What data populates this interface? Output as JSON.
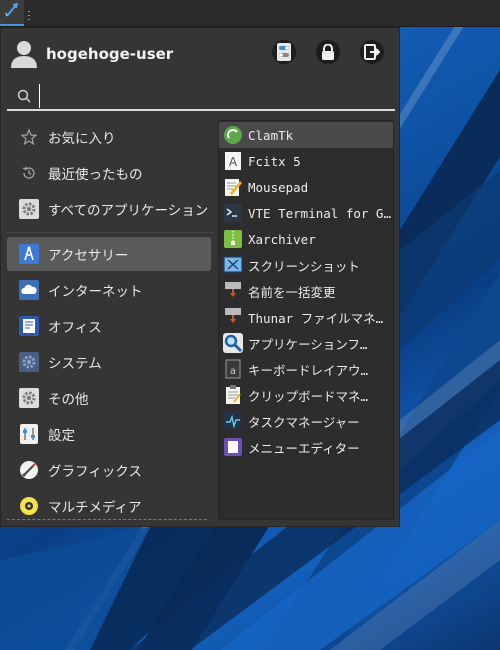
{
  "header": {
    "username": "hogehoge-user",
    "buttons": [
      "settings-icon",
      "lock-icon",
      "logout-icon"
    ]
  },
  "search": {
    "value": "",
    "placeholder": ""
  },
  "categories": [
    {
      "label": "お気に入り",
      "icon": "star-icon"
    },
    {
      "label": "最近使ったもの",
      "icon": "history-icon"
    },
    {
      "label": "すべてのアプリケーション",
      "icon": "gear-icon"
    },
    {
      "label": "アクセサリー",
      "icon": "accessories-icon",
      "active": true
    },
    {
      "label": "インターネット",
      "icon": "cloud-icon"
    },
    {
      "label": "オフィス",
      "icon": "office-icon"
    },
    {
      "label": "システム",
      "icon": "system-gear-icon"
    },
    {
      "label": "その他",
      "icon": "other-gear-icon"
    },
    {
      "label": "設定",
      "icon": "settings-icon"
    },
    {
      "label": "グラフィックス",
      "icon": "graphics-icon"
    },
    {
      "label": "マルチメディア",
      "icon": "multimedia-icon"
    }
  ],
  "apps": [
    {
      "label": "ClamTk",
      "icon": "clamtk-icon",
      "selected": true
    },
    {
      "label": "Fcitx 5",
      "icon": "fcitx-icon"
    },
    {
      "label": "Mousepad",
      "icon": "mousepad-icon"
    },
    {
      "label": "VTE Terminal for G…",
      "icon": "terminal-icon"
    },
    {
      "label": "Xarchiver",
      "icon": "archive-icon"
    },
    {
      "label": "スクリーンショット",
      "icon": "screenshot-icon"
    },
    {
      "label": "名前を一括変更",
      "icon": "rename-icon"
    },
    {
      "label": "Thunar ファイルマネ…",
      "icon": "thunar-icon"
    },
    {
      "label": "アプリケーションフ…",
      "icon": "app-finder-icon"
    },
    {
      "label": "キーボードレイアウ…",
      "icon": "keyboard-layout-icon"
    },
    {
      "label": "クリップボードマネ…",
      "icon": "clipboard-icon"
    },
    {
      "label": "タスクマネージャー",
      "icon": "task-manager-icon"
    },
    {
      "label": "メニューエディター",
      "icon": "menu-editor-icon"
    }
  ],
  "colors": {
    "accent": "#4a90d9",
    "menu_bg": "#353535",
    "list_bg": "#2d2d2d",
    "active_bg": "#5b5b5b"
  }
}
